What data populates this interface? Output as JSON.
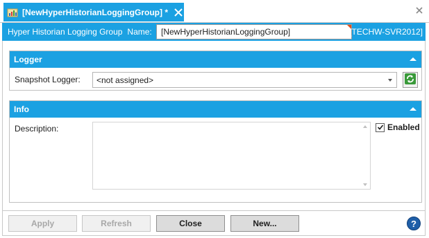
{
  "tab": {
    "title": "[NewHyperHistorianLoggingGroup] *",
    "icon": "logging-group-icon",
    "close_icon": "close-icon"
  },
  "header": {
    "label": "Hyper Historian Logging Group",
    "name_label": "Name:",
    "name_value": "[NewHyperHistorianLoggingGroup]",
    "server": "[TECHW-SVR2012]"
  },
  "logger": {
    "title": "Logger",
    "snapshot_label": "Snapshot Logger:",
    "snapshot_value": "<not assigned>",
    "refresh_icon": "refresh-icon"
  },
  "info": {
    "title": "Info",
    "description_label": "Description:",
    "description_value": "",
    "enabled_label": "Enabled",
    "enabled_checked": true
  },
  "footer": {
    "apply_label": "Apply",
    "refresh_label": "Refresh",
    "close_label": "Close",
    "new_label": "New...",
    "help_label": "?"
  },
  "colors": {
    "accent": "#1ba1e2",
    "help": "#1f5fa8",
    "refresh_green": "#3a9a3a"
  }
}
